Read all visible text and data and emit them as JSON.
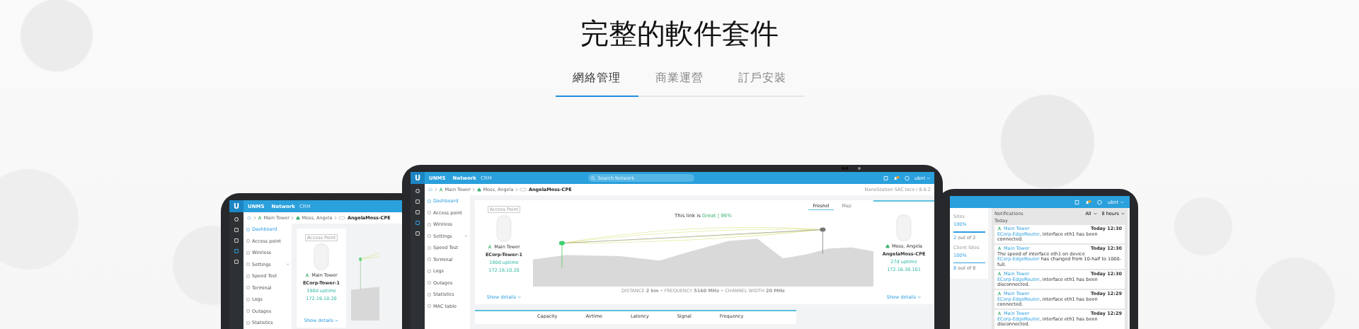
{
  "heading": "完整的軟件套件",
  "tabs": [
    {
      "label": "網絡管理",
      "selected": true
    },
    {
      "label": "商業運營",
      "selected": false
    },
    {
      "label": "訂戶安裝",
      "selected": false
    }
  ],
  "left_laptop": {
    "logo": "U",
    "brand": "UNMS",
    "nav": [
      {
        "label": "Network",
        "selected": true
      },
      {
        "label": "CRM",
        "selected": false
      }
    ],
    "breadcrumbs": [
      {
        "kind": "site",
        "label": "Main Tower"
      },
      {
        "kind": "client",
        "label": "Moss, Angela"
      },
      {
        "kind": "device",
        "label": "AngelaMoss-CPE"
      }
    ],
    "sidebar": [
      {
        "label": "Dashboard",
        "selected": true,
        "expandable": false
      },
      {
        "label": "Access point",
        "selected": false,
        "expandable": false
      },
      {
        "label": "Wireless",
        "selected": false,
        "expandable": false
      },
      {
        "label": "Settings",
        "selected": false,
        "expandable": true
      },
      {
        "label": "Speed Test",
        "selected": false,
        "expandable": false
      },
      {
        "label": "Terminal",
        "selected": false,
        "expandable": false
      },
      {
        "label": "Logs",
        "selected": false,
        "expandable": false
      },
      {
        "label": "Outages",
        "selected": false,
        "expandable": false
      },
      {
        "label": "Statistics",
        "selected": false,
        "expandable": false
      }
    ],
    "device_card": {
      "badge": "Access Point",
      "site": "Main Tower",
      "name": "ECorp-Tower-1",
      "uptime": "190d uptime",
      "ip": "172.16.10.20",
      "link": "Show details"
    }
  },
  "center_laptop": {
    "logo": "U",
    "brand": "UNMS",
    "nav": [
      {
        "label": "Network",
        "selected": true
      },
      {
        "label": "CRM",
        "selected": false
      }
    ],
    "search": {
      "placeholder": "Search Network"
    },
    "user": "ubnt",
    "breadcrumbs": [
      {
        "kind": "site",
        "label": "Main Tower"
      },
      {
        "kind": "client",
        "label": "Moss, Angela"
      },
      {
        "kind": "device",
        "label": "AngelaMoss-CPE"
      }
    ],
    "device_info": "NanoStation 5AC loco / 8.6.2",
    "sidebar": [
      {
        "label": "Dashboard",
        "selected": true,
        "expandable": false
      },
      {
        "label": "Access point",
        "selected": false,
        "expandable": false
      },
      {
        "label": "Wireless",
        "selected": false,
        "expandable": false
      },
      {
        "label": "Settings",
        "selected": false,
        "expandable": true
      },
      {
        "label": "Speed Test",
        "selected": false,
        "expandable": false
      },
      {
        "label": "Terminal",
        "selected": false,
        "expandable": false
      },
      {
        "label": "Logs",
        "selected": false,
        "expandable": false
      },
      {
        "label": "Outages",
        "selected": false,
        "expandable": false
      },
      {
        "label": "Statistics",
        "selected": false,
        "expandable": false
      },
      {
        "label": "MAC table",
        "selected": false,
        "expandable": false
      }
    ],
    "device_card": {
      "badge": "Access Point",
      "site": "Main Tower",
      "name": "ECorp-Tower-1",
      "uptime": "190d uptime",
      "ip": "172.16.10.20",
      "link": "Show details"
    },
    "link_panel": {
      "tabs": [
        {
          "label": "Fresnel",
          "selected": true
        },
        {
          "label": "Map",
          "selected": false
        }
      ],
      "quality_label": "This link is",
      "quality": "Great | 96%",
      "footer": "DISTANCE **2 km** • FREQUENCY **5160 MHz** • CHANNEL WIDTH **20 MHz**"
    },
    "peer_card": {
      "site": "Moss, Angela",
      "name": "AngelaMoss-CPE",
      "uptime": "27d uptime",
      "ip": "172.16.30.101",
      "link": "Show details"
    },
    "stats": [
      "Capacity",
      "Airtime",
      "Latency",
      "Signal",
      "Frequency"
    ]
  },
  "right_laptop": {
    "user": "ubnt",
    "summary": [
      {
        "label": "Sites",
        "value": "100%",
        "level": 1,
        "count": "2",
        "count_suffix": " out of 2"
      },
      {
        "label": "Client Sites",
        "value": "100%",
        "level": 1,
        "count": "8",
        "count_suffix": " out of 8"
      }
    ],
    "notifications": {
      "title": "Notifications",
      "filters": [
        "All",
        "8 hours"
      ],
      "group": "Today",
      "items": [
        {
          "site": "Main Tower",
          "time": "Today 12:30",
          "device": "ECorp-EdgeRouter",
          "after": ", interface eth1 has been connected."
        },
        {
          "site": "Main Tower",
          "time": "Today 12:30",
          "before": "The speed of interface eth1 on device ",
          "device": "ECorp-EdgeRouter",
          "after": " has changed from 10-half to 1000-full."
        },
        {
          "site": "Main Tower",
          "time": "Today 12:30",
          "device": "ECorp-EdgeRouter",
          "after": ", interface eth1 has been disconnected."
        },
        {
          "site": "Main Tower",
          "time": "Today 12:29",
          "device": "ECorp-EdgeRouter",
          "after": ", interface eth1 has been connected."
        },
        {
          "site": "Main Tower",
          "time": "Today 12:29",
          "device": "ECorp-EdgeRouter",
          "after": ", interface eth1 has been disconnected."
        }
      ]
    }
  }
}
